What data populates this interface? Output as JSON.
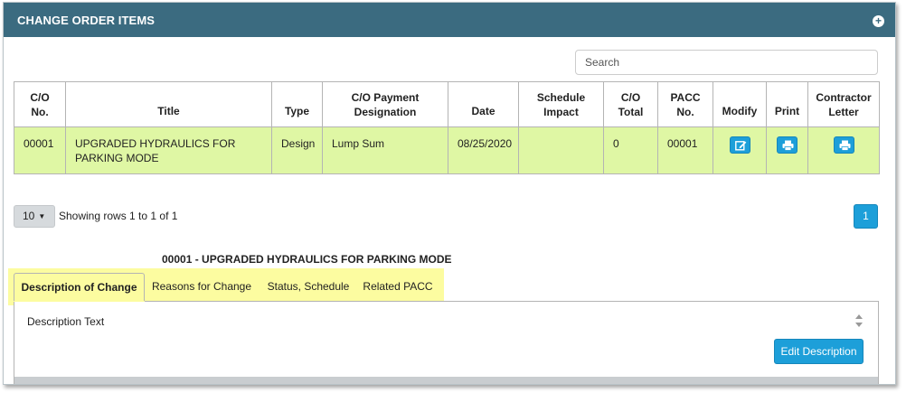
{
  "panel": {
    "title": "CHANGE ORDER ITEMS",
    "expand_icon": "plus-circle-icon"
  },
  "search": {
    "placeholder": "Search",
    "value": ""
  },
  "table": {
    "headers": {
      "co_no": [
        "C/O",
        "No."
      ],
      "title": "Title",
      "type": "Type",
      "payment": [
        "C/O Payment",
        "Designation"
      ],
      "date": "Date",
      "schedule": [
        "Schedule",
        "Impact"
      ],
      "total": [
        "C/O",
        "Total"
      ],
      "pacc": [
        "PACC",
        "No."
      ],
      "modify": "Modify",
      "print": "Print",
      "letter": [
        "Contractor",
        "Letter"
      ]
    },
    "rows": [
      {
        "co_no": "00001",
        "title": "UPGRADED HYDRAULICS FOR PARKING MODE",
        "type": "Design",
        "payment": "Lump Sum",
        "date": "08/25/2020",
        "schedule": "",
        "total": "0",
        "pacc": "00001",
        "modify_icon": "edit-icon",
        "print_icon": "print-icon",
        "letter_icon": "print-icon"
      }
    ],
    "row_highlight_color": "#dff7a4"
  },
  "pagination": {
    "page_size": "10",
    "showing": "Showing rows 1 to 1 of 1",
    "current_page": "1"
  },
  "detail": {
    "title": "00001 - UPGRADED HYDRAULICS FOR PARKING MODE",
    "tabs": [
      {
        "label": "Description of Change",
        "active": true
      },
      {
        "label": "Reasons for Change",
        "active": false
      },
      {
        "label": "Status, Schedule",
        "active": false
      },
      {
        "label": "Related PACC",
        "active": false
      }
    ],
    "content_label": "Description Text",
    "edit_button": "Edit Description"
  },
  "colors": {
    "header_bg": "#3b6b80",
    "accent": "#1d9fd9",
    "tab_highlight": "#fcfca0"
  }
}
